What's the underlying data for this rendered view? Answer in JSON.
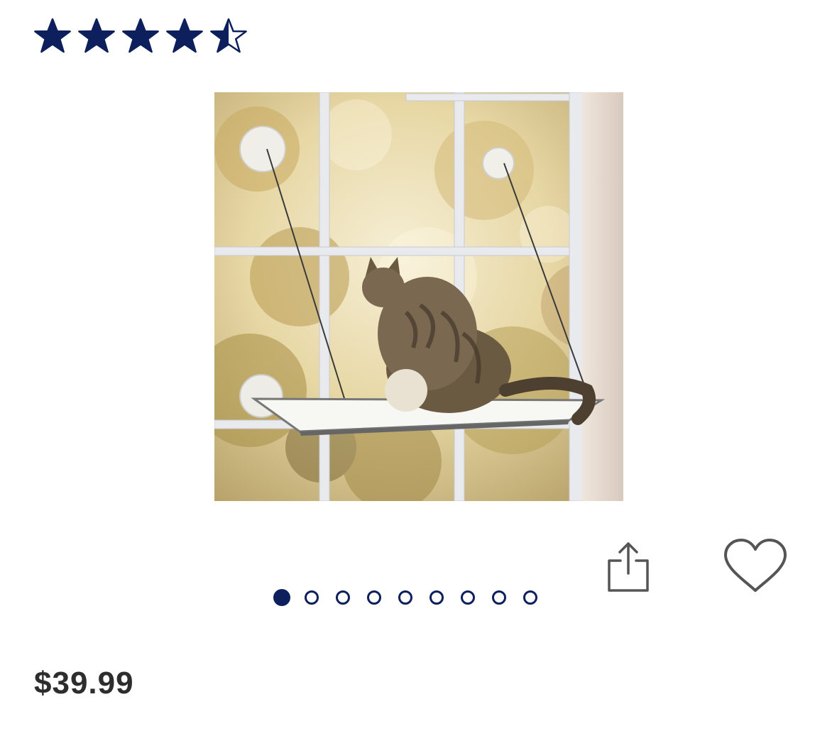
{
  "rating": {
    "value": 4.5,
    "max": 5,
    "icon": "star-icon",
    "color": "#0d1f5c"
  },
  "product": {
    "image_icon": "product-photo"
  },
  "actions": {
    "share_icon": "share-icon",
    "favorite_icon": "heart-icon",
    "icon_color": "#555555"
  },
  "carousel": {
    "total": 9,
    "active_index": 0,
    "color": "#0d1f5c"
  },
  "price": {
    "text": "$39.99"
  }
}
